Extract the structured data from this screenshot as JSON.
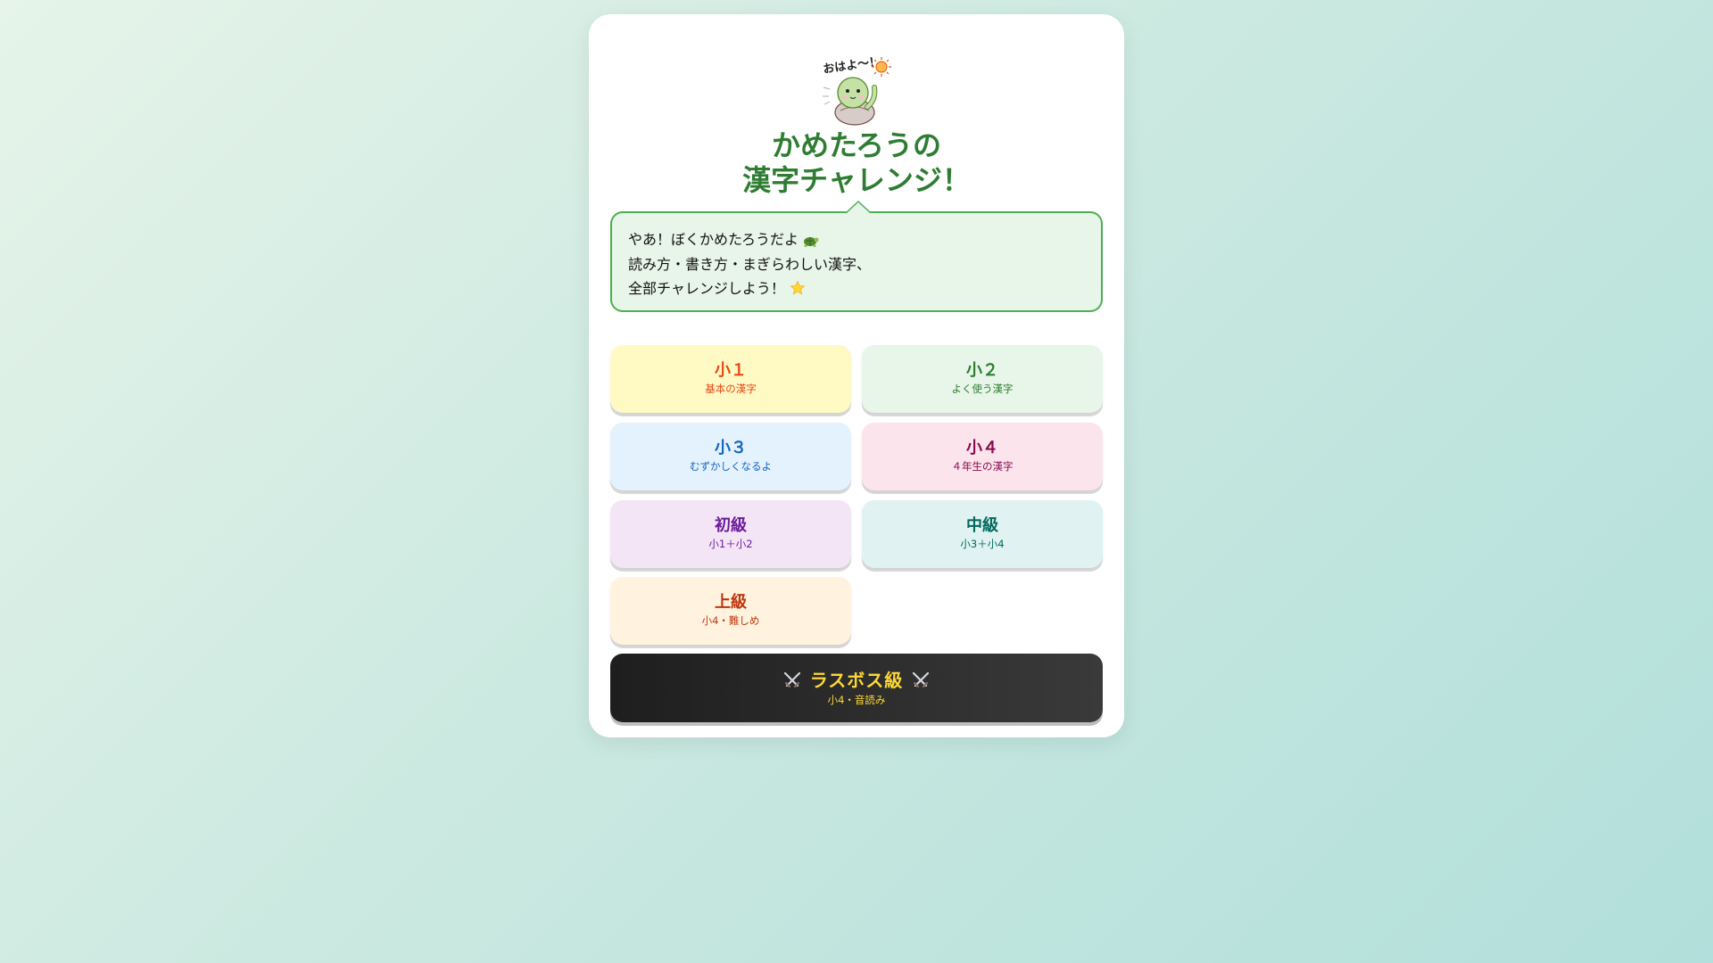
{
  "mascot": {
    "speech": "おはよ〜！",
    "icon": "turtle-mascot"
  },
  "title": {
    "line1": "かめたろうの",
    "line2": "漢字チャレンジ！"
  },
  "bubble": {
    "line1": "やあ！ぼくかめたろうだよ",
    "line1_icon": "turtle-icon",
    "line2": "読み方・書き方・まぎらわしい漢字、",
    "line3": "全部チャレンジしよう！",
    "line3_icon": "star-icon"
  },
  "levels": [
    {
      "label": "小１",
      "sub": "基本の漢字",
      "color": "#e64a19",
      "bg": "#fff9c4"
    },
    {
      "label": "小２",
      "sub": "よく使う漢字",
      "color": "#2e7d32",
      "bg": "#e8f5e9"
    },
    {
      "label": "小３",
      "sub": "むずかしくなるよ",
      "color": "#1565c0",
      "bg": "#e3f2fd"
    },
    {
      "label": "小４",
      "sub": "４年生の漢字",
      "color": "#880e4f",
      "bg": "#fce4ec"
    },
    {
      "label": "初級",
      "sub": "小1＋小2",
      "color": "#6a1b9a",
      "bg": "#f3e5f5"
    },
    {
      "label": "中級",
      "sub": "小3＋小4",
      "color": "#00695c",
      "bg": "#e0f2f1"
    },
    {
      "label": "上級",
      "sub": "小4・難しめ",
      "color": "#bf360c",
      "bg": "#fff3e0"
    }
  ],
  "boss": {
    "label": "ラスボス級",
    "sub": "小4・音読み",
    "icon": "crossed-swords-icon",
    "color": "#fdd835"
  }
}
